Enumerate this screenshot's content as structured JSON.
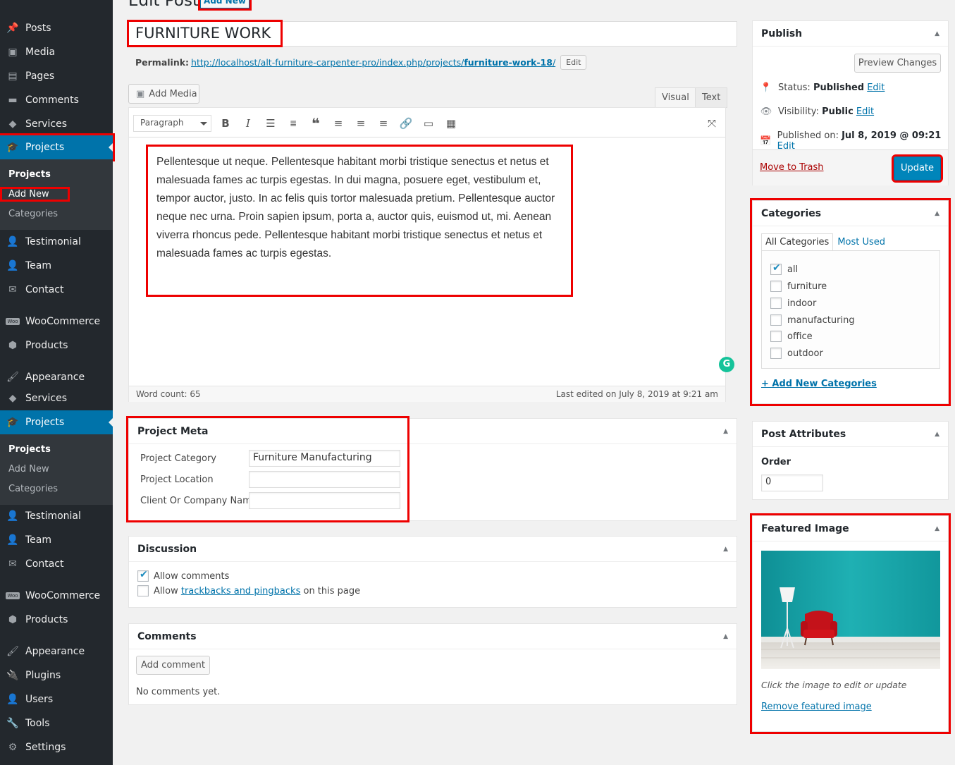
{
  "page": {
    "title": "Edit Post",
    "add_new": "Add New"
  },
  "post": {
    "title": "FURNITURE WORK",
    "permalink_label": "Permalink:",
    "permalink_url_base": "http://localhost/alt-furniture-carpenter-pro/index.php/projects/",
    "permalink_slug": "furniture-work-18",
    "permalink_url_end": "/",
    "permalink_edit": "Edit",
    "content": "Pellentesque ut neque. Pellentesque habitant morbi tristique senectus et netus et malesuada fames ac turpis egestas. In dui magna, posuere eget, vestibulum et, tempor auctor, justo. In ac felis quis tortor malesuada pretium. Pellentesque auctor neque nec urna. Proin sapien ipsum, porta a, auctor quis, euismod ut, mi. Aenean viverra rhoncus pede. Pellentesque habitant morbi tristique senectus et netus et malesuada fames ac turpis egestas."
  },
  "editor": {
    "add_media": "Add Media",
    "tab_visual": "Visual",
    "tab_text": "Text",
    "format": "Paragraph",
    "word_count": "Word count: 65",
    "last_edited": "Last edited on July 8, 2019 at 9:21 am",
    "grammarly": "G"
  },
  "sidebar": {
    "menu": [
      {
        "label": "Posts",
        "icon": "pin-icon"
      },
      {
        "label": "Media",
        "icon": "media-icon"
      },
      {
        "label": "Pages",
        "icon": "pages-icon"
      },
      {
        "label": "Comments",
        "icon": "comments-icon"
      },
      {
        "label": "Services",
        "icon": "tag-icon"
      },
      {
        "label": "Projects",
        "icon": "graduation-cap-icon"
      },
      {
        "label": "Testimonial",
        "icon": "user-icon"
      },
      {
        "label": "Team",
        "icon": "user-icon"
      },
      {
        "label": "Contact",
        "icon": "envelope-icon"
      },
      {
        "label": "WooCommerce",
        "icon": "woo-icon"
      },
      {
        "label": "Products",
        "icon": "box-icon"
      },
      {
        "label": "Appearance",
        "icon": "brush-icon"
      },
      {
        "label": "Services",
        "icon": "tag-icon"
      },
      {
        "label": "Projects",
        "icon": "graduation-cap-icon"
      },
      {
        "label": "Testimonial",
        "icon": "user-icon"
      },
      {
        "label": "Team",
        "icon": "user-icon"
      },
      {
        "label": "Contact",
        "icon": "envelope-icon"
      },
      {
        "label": "WooCommerce",
        "icon": "woo-icon"
      },
      {
        "label": "Products",
        "icon": "box-icon"
      },
      {
        "label": "Appearance",
        "icon": "brush-icon"
      },
      {
        "label": "Plugins",
        "icon": "plug-icon"
      },
      {
        "label": "Users",
        "icon": "user-icon"
      },
      {
        "label": "Tools",
        "icon": "wrench-icon"
      },
      {
        "label": "Settings",
        "icon": "settings-icon"
      }
    ],
    "submenu_1": [
      "Projects",
      "Add New",
      "Categories"
    ],
    "submenu_2": [
      "Projects",
      "Add New",
      "Categories"
    ],
    "woo_badge": "Woo"
  },
  "project_meta": {
    "title": "Project Meta",
    "fields": [
      {
        "label": "Project Category",
        "value": "Furniture Manufacturing"
      },
      {
        "label": "Project Location",
        "value": ""
      },
      {
        "label": "Client Or Company Name",
        "value": ""
      }
    ]
  },
  "discussion": {
    "title": "Discussion",
    "allow_comments": "Allow comments",
    "allow_prefix": "Allow",
    "trackbacks_link": "trackbacks and pingbacks",
    "allow_suffix": "on this page"
  },
  "comments": {
    "title": "Comments",
    "add_comment": "Add comment",
    "none": "No comments yet."
  },
  "publish": {
    "title": "Publish",
    "preview": "Preview Changes",
    "status_label": "Status:",
    "status_value": "Published",
    "visibility_label": "Visibility:",
    "visibility_value": "Public",
    "published_label": "Published on:",
    "published_value": "Jul 8, 2019 @ 09:21",
    "edit": "Edit",
    "trash": "Move to Trash",
    "update": "Update"
  },
  "categories": {
    "title": "Categories",
    "tab_all": "All Categories",
    "tab_used": "Most Used",
    "items": [
      {
        "label": "all",
        "checked": true
      },
      {
        "label": "furniture",
        "checked": false
      },
      {
        "label": "indoor",
        "checked": false
      },
      {
        "label": "manufacturing",
        "checked": false
      },
      {
        "label": "office",
        "checked": false
      },
      {
        "label": "outdoor",
        "checked": false
      }
    ],
    "add_new": "+ Add New Categories"
  },
  "post_attributes": {
    "title": "Post Attributes",
    "order_label": "Order",
    "order_value": "0"
  },
  "featured_image": {
    "title": "Featured Image",
    "hint": "Click the image to edit or update",
    "remove": "Remove featured image"
  },
  "colors": {
    "accent": "#0073aa",
    "sidebar_bg": "#23282d",
    "highlight": "#e00000",
    "teal_wall": "#1aa3a8",
    "chair_red": "#d2141b"
  }
}
